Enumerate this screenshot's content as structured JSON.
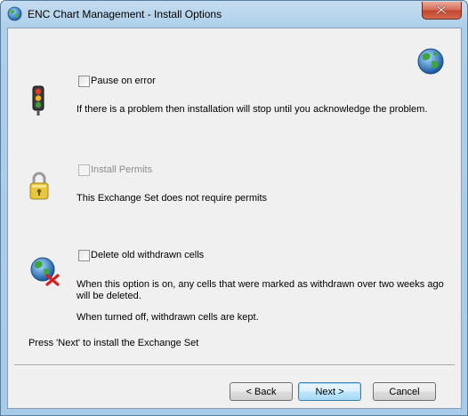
{
  "window": {
    "title": "ENC Chart Management - Install Options"
  },
  "options": {
    "pause": {
      "label": "Pause on error",
      "checked": false,
      "enabled": true,
      "description": "If there is a problem then installation will stop until you acknowledge the problem.",
      "icon": "traffic-light-icon"
    },
    "permits": {
      "label": "Install Permits",
      "checked": false,
      "enabled": false,
      "description": "This Exchange Set does not require permits",
      "icon": "padlock-icon"
    },
    "withdrawn": {
      "label": "Delete old withdrawn cells",
      "checked": false,
      "enabled": true,
      "description_line1": "When this option is on, any cells that were marked as withdrawn over two weeks ago",
      "description_line2": "will be deleted.",
      "description_off": "When turned off, withdrawn cells are kept.",
      "icon": "globe-delete-icon"
    }
  },
  "footer_text": "Press 'Next' to install the Exchange Set",
  "buttons": {
    "back": "< Back",
    "next": "Next >",
    "cancel": "Cancel"
  },
  "colors": {
    "default_button_border": "#3c7fb1",
    "close_button": "#c5452e"
  }
}
